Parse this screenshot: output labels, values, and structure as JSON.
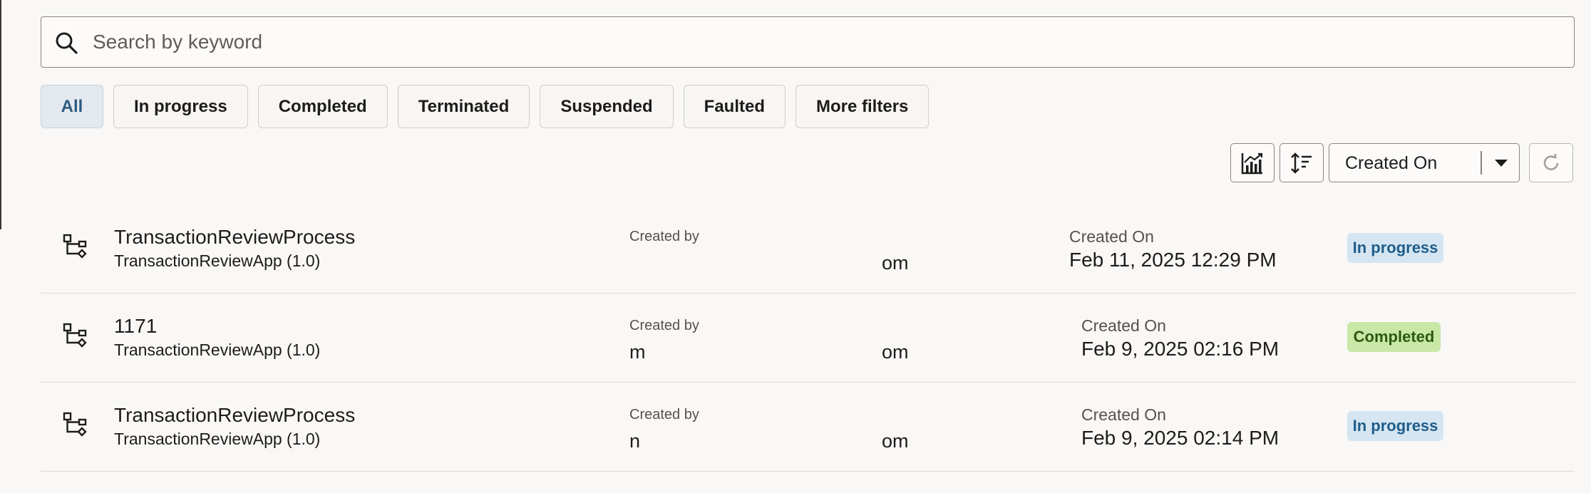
{
  "search": {
    "placeholder": "Search by keyword"
  },
  "filters": [
    {
      "label": "All",
      "active": true
    },
    {
      "label": "In progress"
    },
    {
      "label": "Completed"
    },
    {
      "label": "Terminated"
    },
    {
      "label": "Suspended"
    },
    {
      "label": "Faulted"
    },
    {
      "label": "More filters"
    }
  ],
  "toolbar": {
    "chart_icon": "chart-icon",
    "sort_icon": "sort-order-icon",
    "sort_field": "Created On",
    "refresh_icon": "refresh-icon"
  },
  "rows": [
    {
      "title": "TransactionReviewProcess",
      "app": "TransactionReviewApp (1.0)",
      "created_by_label": "Created by",
      "created_by_start": "",
      "created_by_end": "om",
      "created_on_label": "Created On",
      "created_on": "Feb 11, 2025 12:29 PM",
      "status": "In progress"
    },
    {
      "title": "1171",
      "app": "TransactionReviewApp (1.0)",
      "created_by_label": "Created by",
      "created_by_start": "m",
      "created_by_end": "om",
      "created_on_label": "Created On",
      "created_on": "Feb 9, 2025 02:16 PM",
      "status": "Completed"
    },
    {
      "title": "TransactionReviewProcess",
      "app": "TransactionReviewApp (1.0)",
      "created_by_label": "Created by",
      "created_by_start": "n",
      "created_by_end": "om",
      "created_on_label": "Created On",
      "created_on": "Feb 9, 2025 02:14 PM",
      "status": "In progress"
    }
  ],
  "colors": {
    "in_progress_bg": "#d5e6f2",
    "in_progress_text": "#1f5d8a",
    "completed_bg": "#c9e8a8",
    "completed_text": "#2d5a12",
    "active_chip_text": "#2a5a7f"
  }
}
